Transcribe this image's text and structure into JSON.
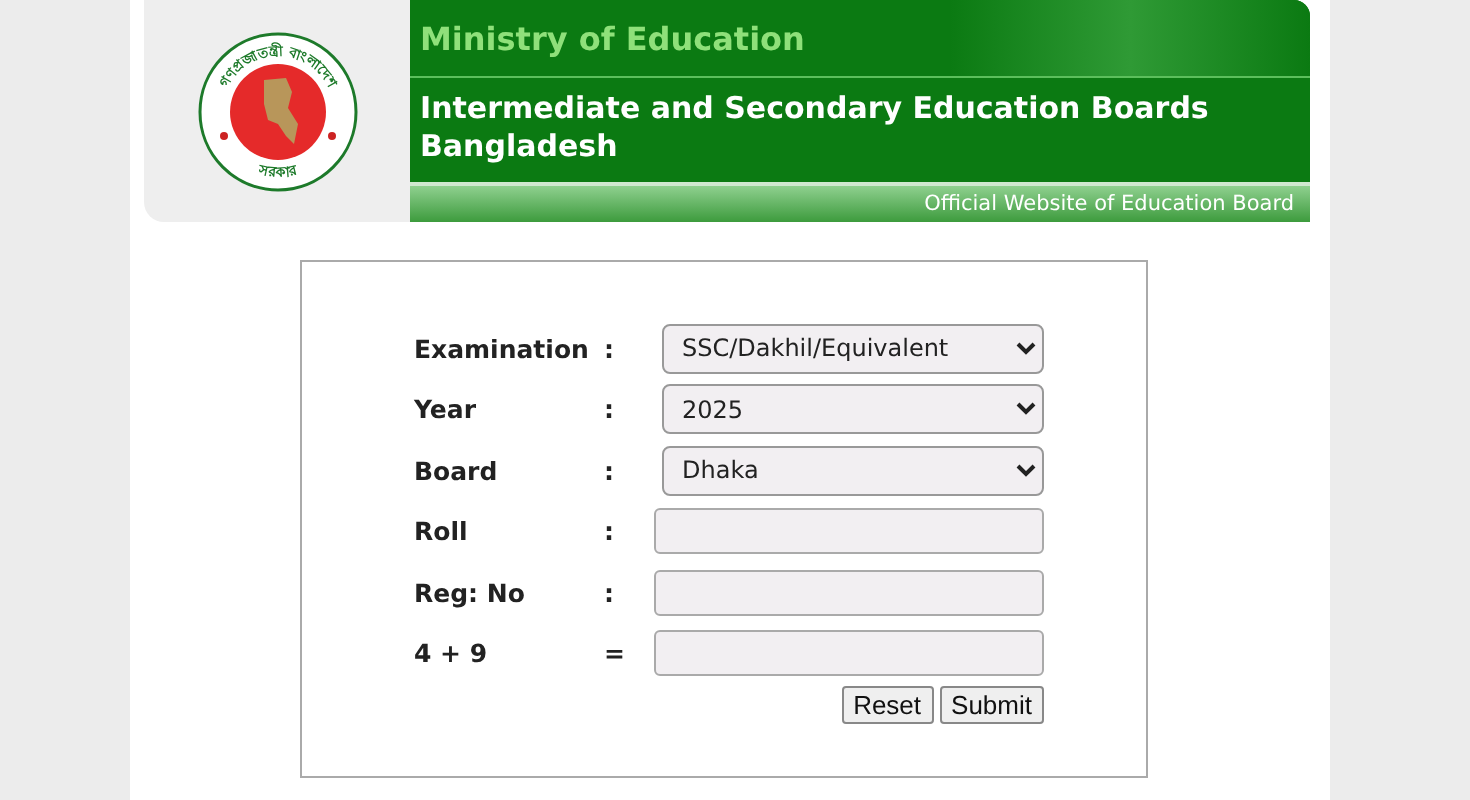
{
  "header": {
    "seal": {
      "top_text": "গণপ্রজাতন্ত্রী বাংলাদেশ",
      "bottom_text": "সরকার"
    },
    "ministry": "Ministry of Education",
    "title": "Intermediate and Secondary Education Boards Bangladesh",
    "tagline": "Official Website of Education Board"
  },
  "form": {
    "fields": [
      {
        "kind": "select",
        "label": "Examination",
        "separator": ":",
        "value": "SSC/Dakhil/Equivalent"
      },
      {
        "kind": "select",
        "label": "Year",
        "separator": ":",
        "value": "2025"
      },
      {
        "kind": "select",
        "label": "Board",
        "separator": ":",
        "value": "Dhaka"
      },
      {
        "kind": "input",
        "label": "Roll",
        "separator": ":"
      },
      {
        "kind": "input",
        "label": "Reg: No",
        "separator": ":"
      },
      {
        "kind": "input",
        "label": "4 + 9",
        "separator": "="
      }
    ],
    "buttons": [
      "Reset",
      "Submit"
    ]
  }
}
